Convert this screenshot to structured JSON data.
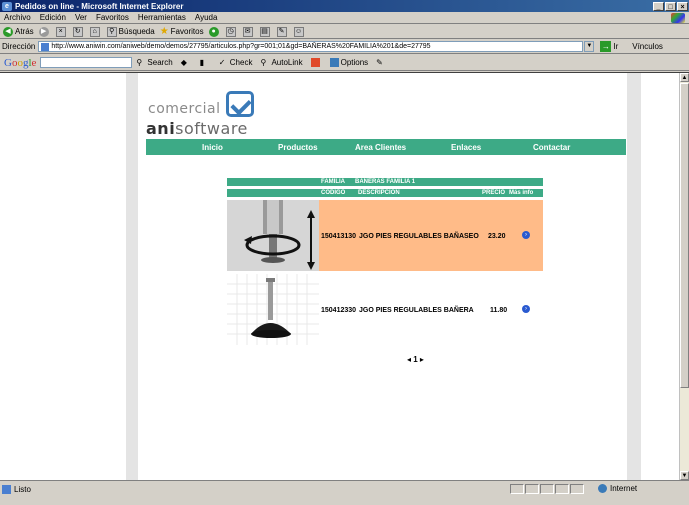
{
  "window": {
    "title": "Pedidos on line - Microsoft Internet Explorer",
    "buttons": [
      "_",
      "□",
      "×"
    ]
  },
  "menu": [
    "Archivo",
    "Edición",
    "Ver",
    "Favoritos",
    "Herramientas",
    "Ayuda"
  ],
  "toolbar": {
    "back": "Atrás",
    "search": "Búsqueda",
    "favorites": "Favoritos"
  },
  "address": {
    "label": "Dirección",
    "url": "http://www.aniwin.com/aniweb/demo/demos/27795/articulos.php?gr=001;01&gd=BAÑERAS%20FAMILIA%201&de=27795",
    "go": "Ir",
    "links": "Vínculos"
  },
  "googlebar": {
    "logo": "Google",
    "search": "Search",
    "check": "Check",
    "autolink": "AutoLink",
    "options": "Options"
  },
  "site": {
    "logo_line1": "comercial",
    "logo_line2_a": "ani",
    "logo_line2_b": "software",
    "nav": [
      "Inicio",
      "Productos",
      "Area Clientes",
      "Enlaces",
      "Contactar"
    ]
  },
  "catalog": {
    "family_label": "FAMILIA",
    "family_value": "BAÑERAS FAMILIA 1",
    "columns": [
      "CODIGO",
      "DESCRIPCION",
      "PRECIO",
      "Más info"
    ],
    "rows": [
      {
        "code": "150413130",
        "desc": "JGO PIES REGULABLES BAÑASEO",
        "price": "23.20"
      },
      {
        "code": "150412330",
        "desc": "JGO PIES REGULABLES BAÑERA",
        "price": "11.80"
      }
    ],
    "pager": "◂ 1 ▸"
  },
  "status": {
    "text": "Listo",
    "zone": "Internet"
  },
  "colors": {
    "nav_green": "#3daa86",
    "row_highlight": "#ffbb88",
    "title_blue": "#0a246a"
  }
}
